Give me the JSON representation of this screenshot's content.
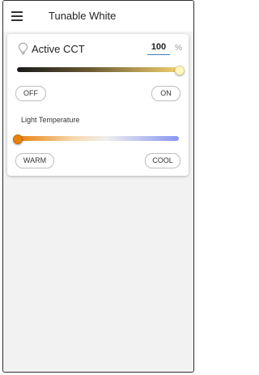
{
  "header": {
    "title": "Tunable White"
  },
  "cct": {
    "label": "Active CCT",
    "value": "100",
    "unit": "%",
    "level": 1.0,
    "off_label": "OFF",
    "on_label": "ON"
  },
  "temperature": {
    "label": "Light Temperature",
    "level": 0.0,
    "warm_label": "WARM",
    "cool_label": "COOL"
  },
  "colors": {
    "brightness_start": "#1a1a1a",
    "brightness_end": "#f2cf6e",
    "warm": "#e8820e",
    "cool": "#8a96f2",
    "accent": "#3f7fbf"
  }
}
